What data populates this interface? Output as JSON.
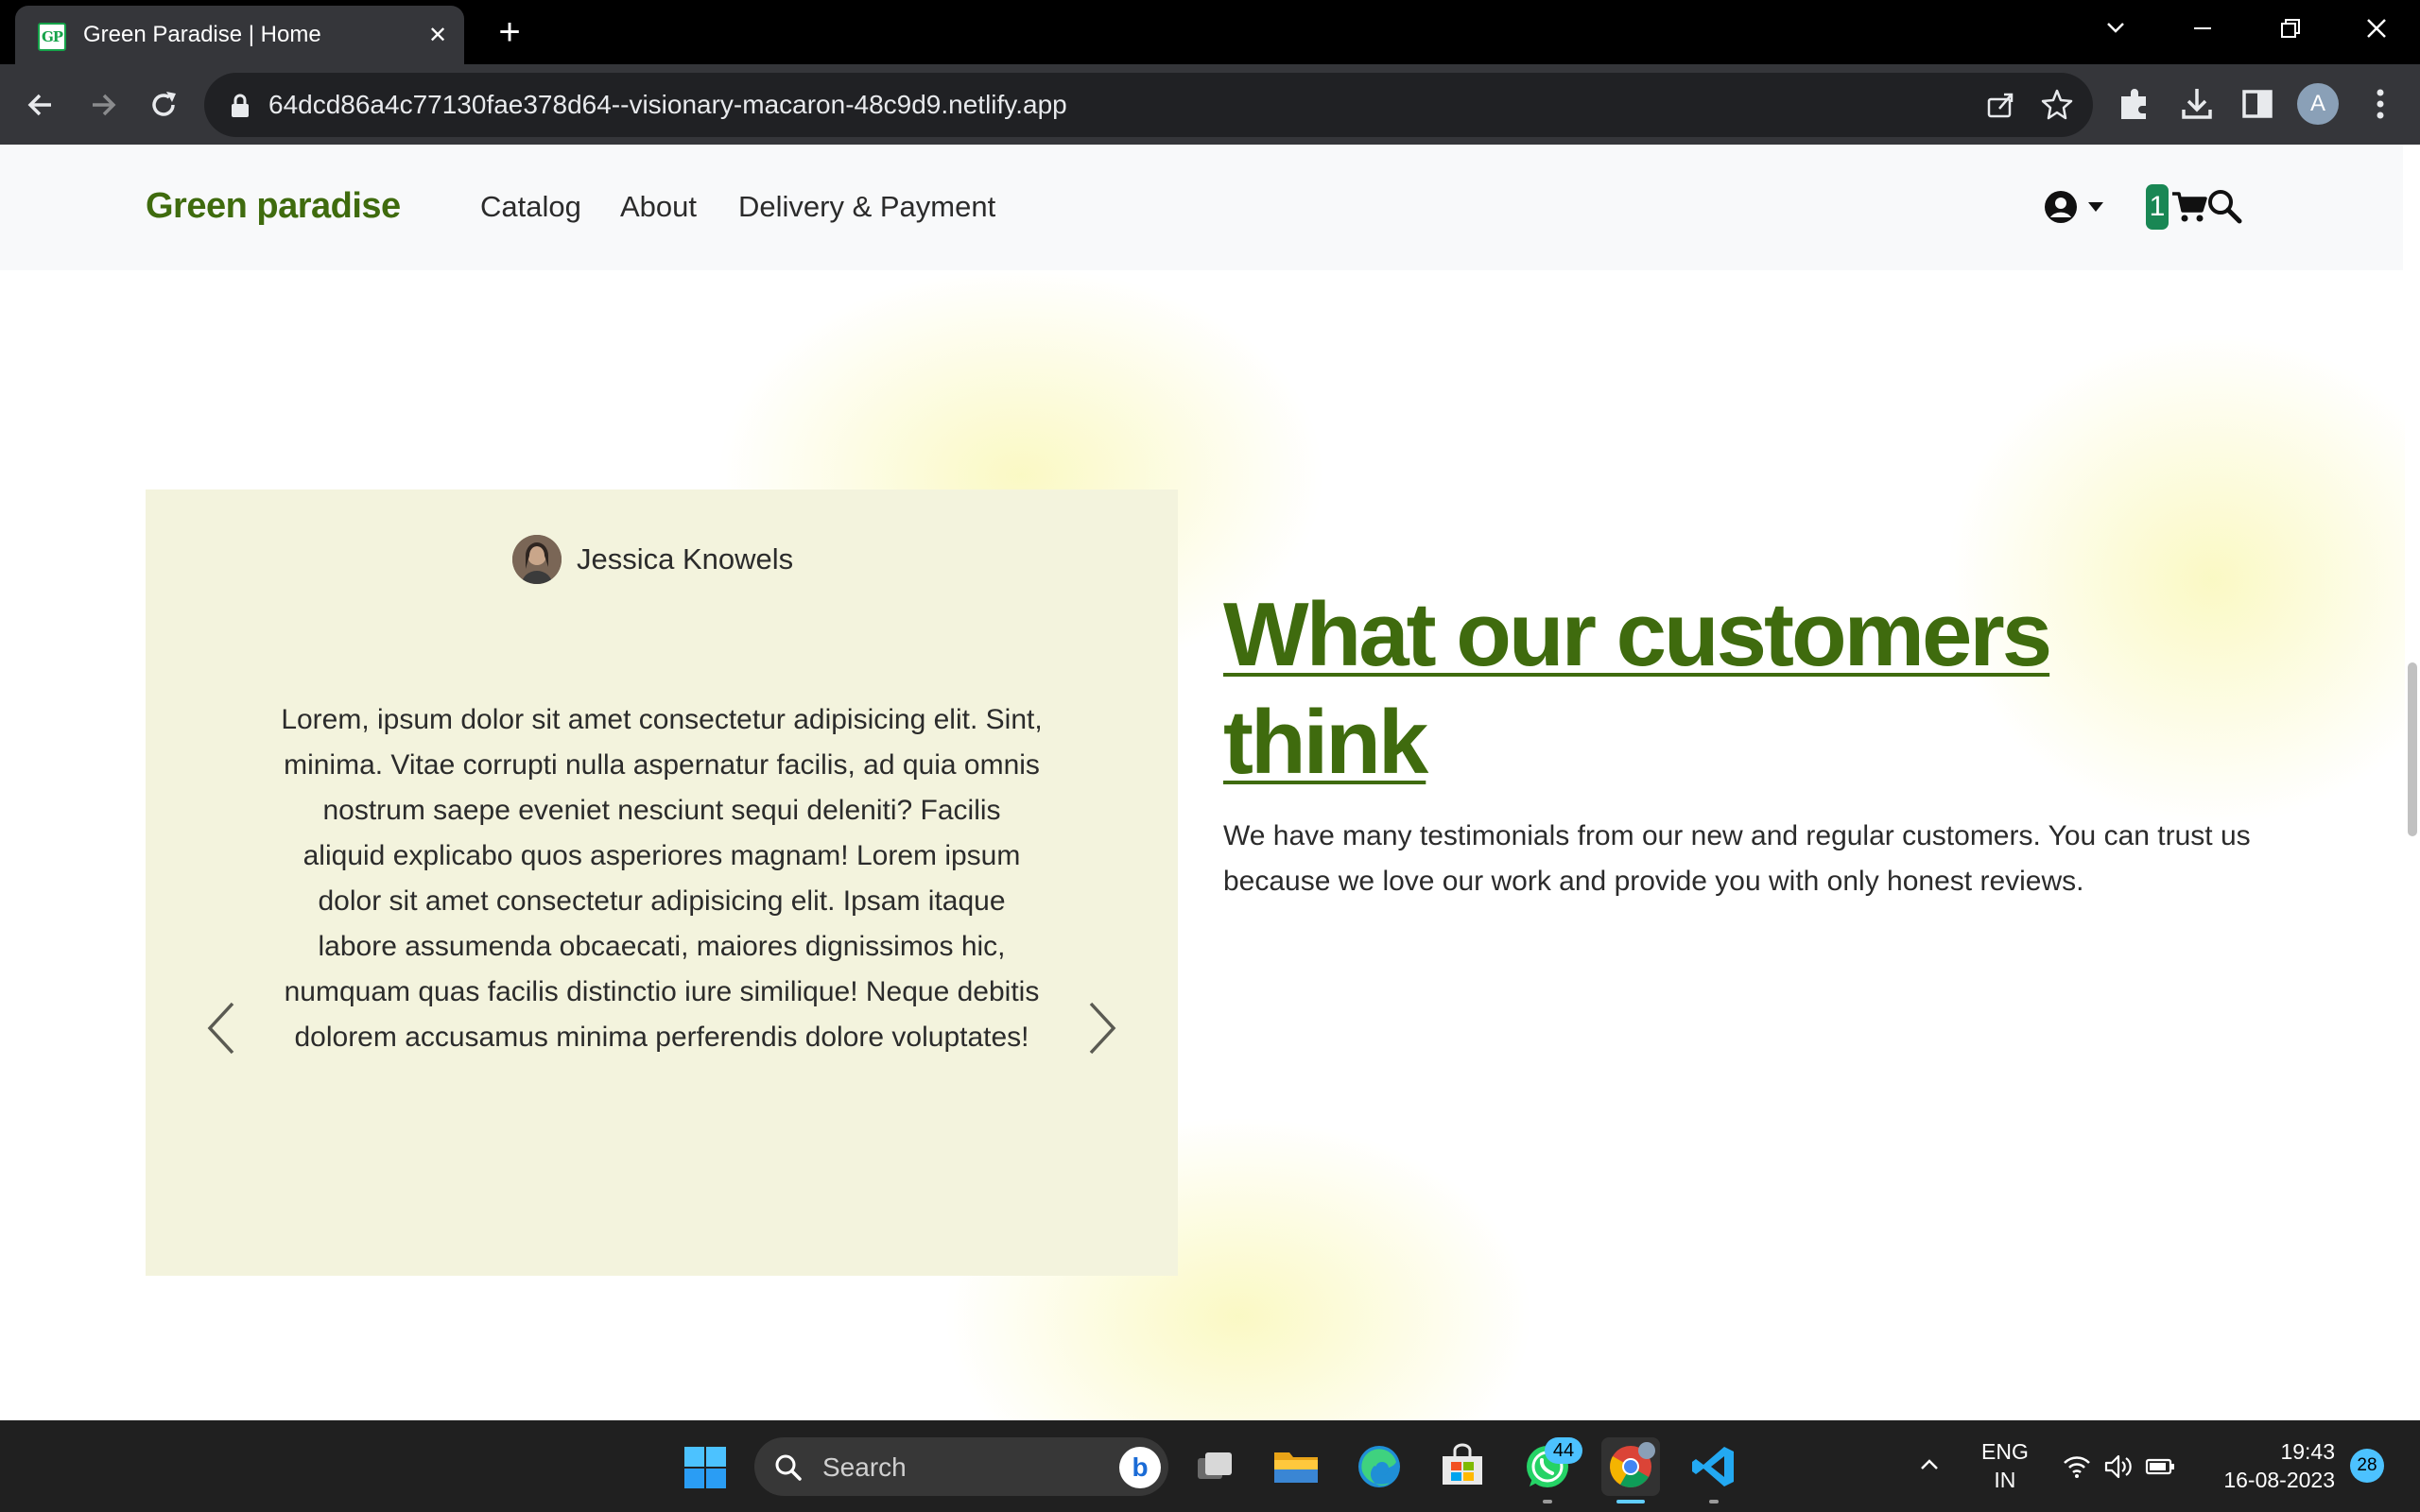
{
  "browser": {
    "tab": {
      "favicon_text": "GP",
      "title": "Green Paradise | Home",
      "close_glyph": "✕"
    },
    "new_tab_glyph": "+",
    "url": "64dcd86a4c77130fae378d64--visionary-macaron-48c9d9.netlify.app",
    "profile_initial": "A"
  },
  "site": {
    "brand": "Green paradise",
    "nav": [
      {
        "label": "Catalog"
      },
      {
        "label": "About"
      },
      {
        "label": "Delivery & Payment"
      }
    ],
    "cart_count": "1"
  },
  "testimonial": {
    "reviewer": "Jessica Knowels",
    "text": "Lorem, ipsum dolor sit amet consectetur adipisicing elit. Sint, minima. Vitae corrupti nulla aspernatur facilis, ad quia omnis nostrum saepe eveniet nesciunt sequi deleniti? Facilis aliquid explicabo quos asperiores magnam! Lorem ipsum dolor sit amet consectetur adipisicing elit. Ipsam itaque labore assumenda obcaecati, maiores dignissimos hic, numquam quas facilis distinctio iure similique! Neque debitis dolorem accusamus minima perferendis dolore voluptates!"
  },
  "section": {
    "heading": "What our customers think",
    "body": "We have many testimonials from our new and regular customers. You can trust us because we love our work and provide you with only honest reviews."
  },
  "taskbar": {
    "search_label": "Search",
    "bing_glyph": "b",
    "whatsapp_badge": "44",
    "language": "ENG",
    "region": "IN",
    "time": "19:43",
    "date": "16-08-2023",
    "notifications": "28"
  },
  "colors": {
    "brand_green": "#3f6b0e",
    "card_bg": "#f3f3dd",
    "badge_green": "#198754",
    "chrome_bg": "#35363a"
  }
}
